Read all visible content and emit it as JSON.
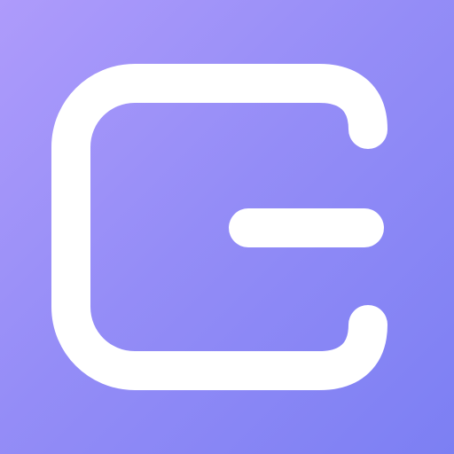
{
  "icon": {
    "name": "logo-mark",
    "semantic": "bracket-with-bar-logo",
    "colors": {
      "gradient_start": "#ae9bfb",
      "gradient_mid": "#958df7",
      "gradient_end": "#7c7ff3",
      "glyph": "#ffffff"
    }
  }
}
